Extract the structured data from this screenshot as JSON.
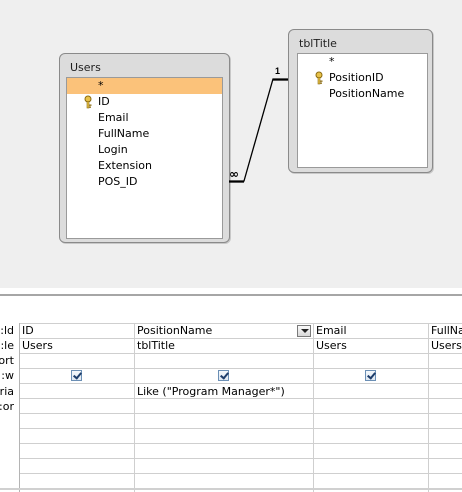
{
  "diagram": {
    "tables": [
      {
        "title": "Users",
        "fields": [
          {
            "name": "*",
            "key": false,
            "selected": true
          },
          {
            "name": "ID",
            "key": true,
            "selected": false
          },
          {
            "name": "Email",
            "key": false,
            "selected": false
          },
          {
            "name": "FullName",
            "key": false,
            "selected": false
          },
          {
            "name": "Login",
            "key": false,
            "selected": false
          },
          {
            "name": "Extension",
            "key": false,
            "selected": false
          },
          {
            "name": "POS_ID",
            "key": false,
            "selected": false
          }
        ]
      },
      {
        "title": "tblTitle",
        "fields": [
          {
            "name": "*",
            "key": false,
            "selected": false
          },
          {
            "name": "PositionID",
            "key": true,
            "selected": false
          },
          {
            "name": "PositionName",
            "key": false,
            "selected": false
          }
        ]
      }
    ],
    "relationship": {
      "one_label": "1",
      "many_label": "∞"
    }
  },
  "grid": {
    "row_labels": [
      "ld:",
      "le:",
      "ort:",
      "w:",
      "ria:",
      "or:"
    ],
    "columns": [
      {
        "field": "ID",
        "table": "Users",
        "sort": "",
        "show": true,
        "criteria": "",
        "or": "",
        "has_dropdown": false
      },
      {
        "field": "PositionName",
        "table": "tblTitle",
        "sort": "",
        "show": true,
        "criteria": "Like (\"Program Manager*\")",
        "or": "",
        "has_dropdown": true
      },
      {
        "field": "Email",
        "table": "Users",
        "sort": "",
        "show": true,
        "criteria": "",
        "or": "",
        "has_dropdown": false
      },
      {
        "field": "FullNa",
        "table": "Users",
        "sort": "",
        "show": false,
        "criteria": "",
        "or": "",
        "has_dropdown": false
      }
    ]
  }
}
